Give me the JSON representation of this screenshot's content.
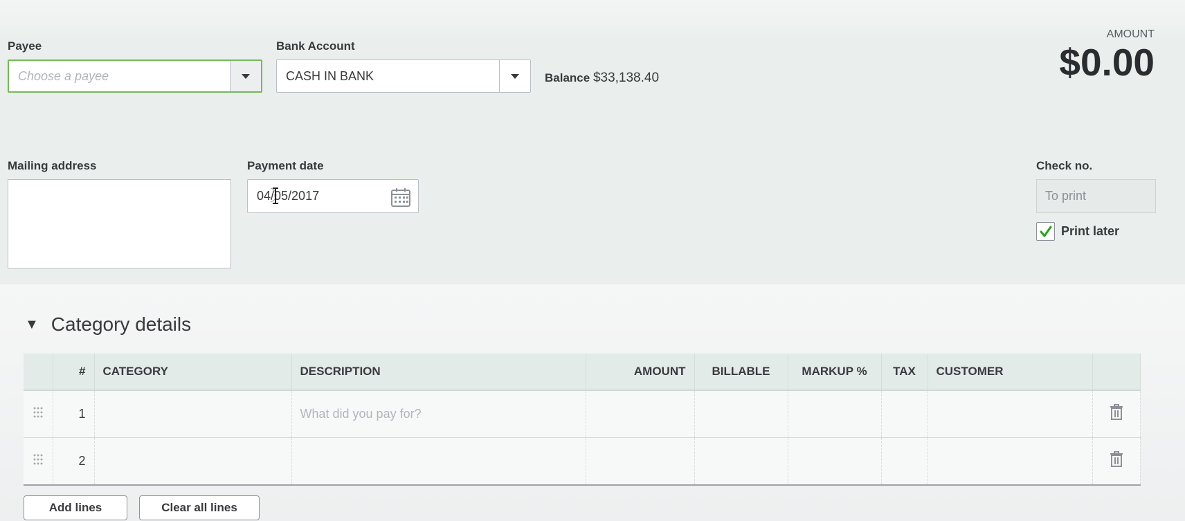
{
  "header": {
    "payee_label": "Payee",
    "payee_placeholder": "Choose a payee",
    "bank_account_label": "Bank Account",
    "bank_account_value": "CASH IN BANK",
    "balance_label": "Balance",
    "balance_value": "$33,138.40",
    "amount_label": "AMOUNT",
    "amount_value": "$0.00"
  },
  "details": {
    "mailing_address_label": "Mailing address",
    "mailing_address_value": "",
    "payment_date_label": "Payment date",
    "payment_date_value": "04/05/2017",
    "check_no_label": "Check no.",
    "check_no_placeholder": "To print",
    "print_later_label": "Print later",
    "print_later_checked": true
  },
  "category_details": {
    "title": "Category details",
    "columns": [
      "#",
      "CATEGORY",
      "DESCRIPTION",
      "AMOUNT",
      "BILLABLE",
      "MARKUP %",
      "TAX",
      "CUSTOMER"
    ],
    "rows": [
      {
        "num": "1",
        "description_placeholder": "What did you pay for?"
      },
      {
        "num": "2",
        "description_placeholder": ""
      }
    ],
    "add_lines_label": "Add lines",
    "clear_all_lines_label": "Clear all lines"
  },
  "colors": {
    "focus_border": "#74b95b",
    "check_green": "#2ca01c",
    "header_bg": "#e3ebe8"
  }
}
